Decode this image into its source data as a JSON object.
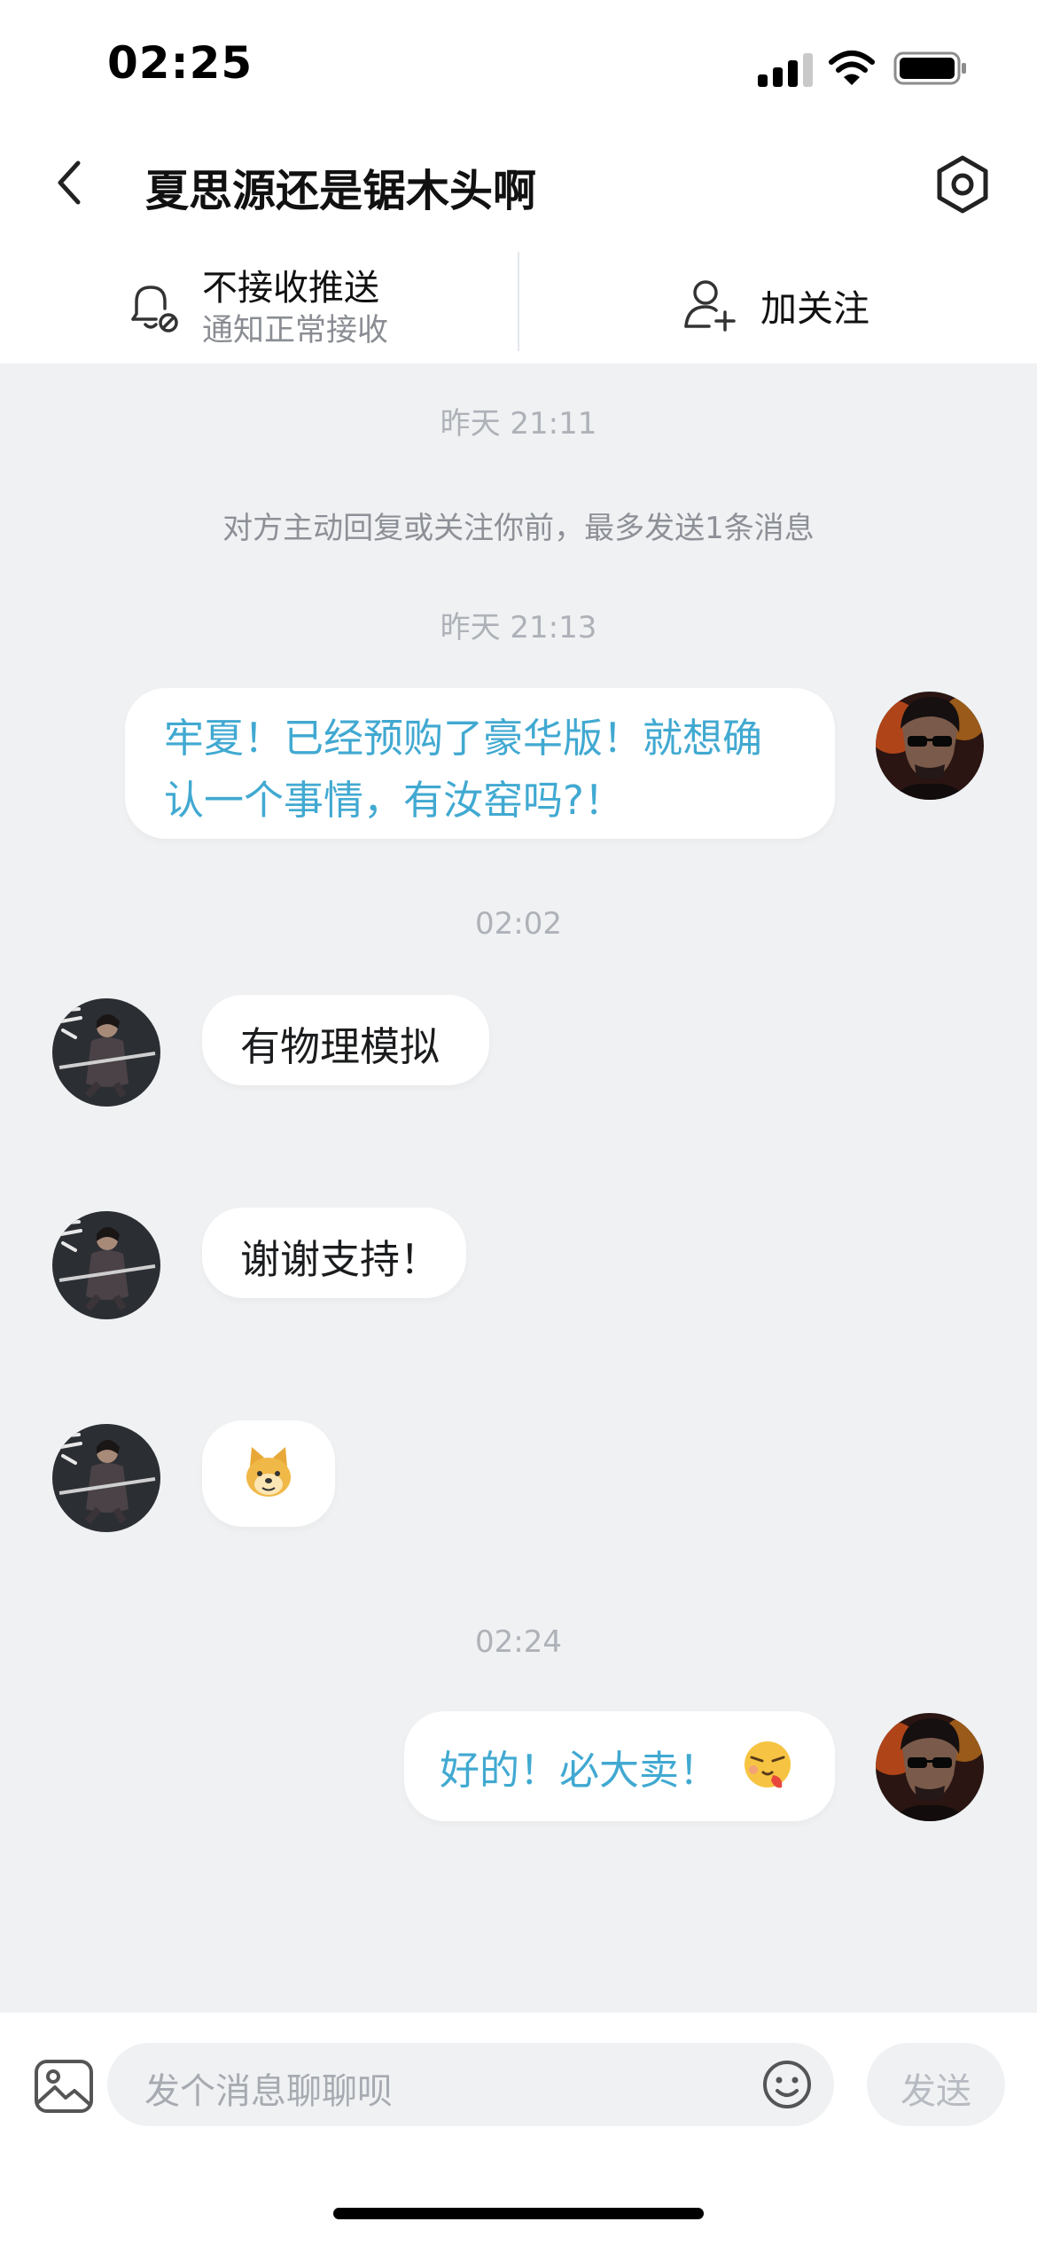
{
  "status_bar": {
    "time": "02:25"
  },
  "header": {
    "title": "夏思源还是锯木头啊"
  },
  "subheader": {
    "push_label": "不接收推送",
    "push_sub": "通知正常接收",
    "follow_label": "加关注"
  },
  "messages": {
    "ts1": "昨天 21:11",
    "notice": "对方主动回复或关注你前，最多发送1条消息",
    "ts2": "昨天 21:13",
    "m1_line1": "牢夏！已经预购了豪华版！就想确",
    "m1_line2": "认一个事情，有汝窑吗?！",
    "ts3": "02:02",
    "m2": "有物理模拟",
    "m3": "谢谢支持！",
    "m4_sticker": "doge-emoji",
    "ts4": "02:24",
    "m5": "好的！必大卖！",
    "m5_emoji": "tongue-out-emoji"
  },
  "input": {
    "placeholder": "发个消息聊聊呗",
    "send_label": "发送"
  },
  "colors": {
    "outgoing_text": "#41a9d1",
    "incoming_text": "#1b1c1e",
    "chat_bg": "#eff1f3"
  }
}
